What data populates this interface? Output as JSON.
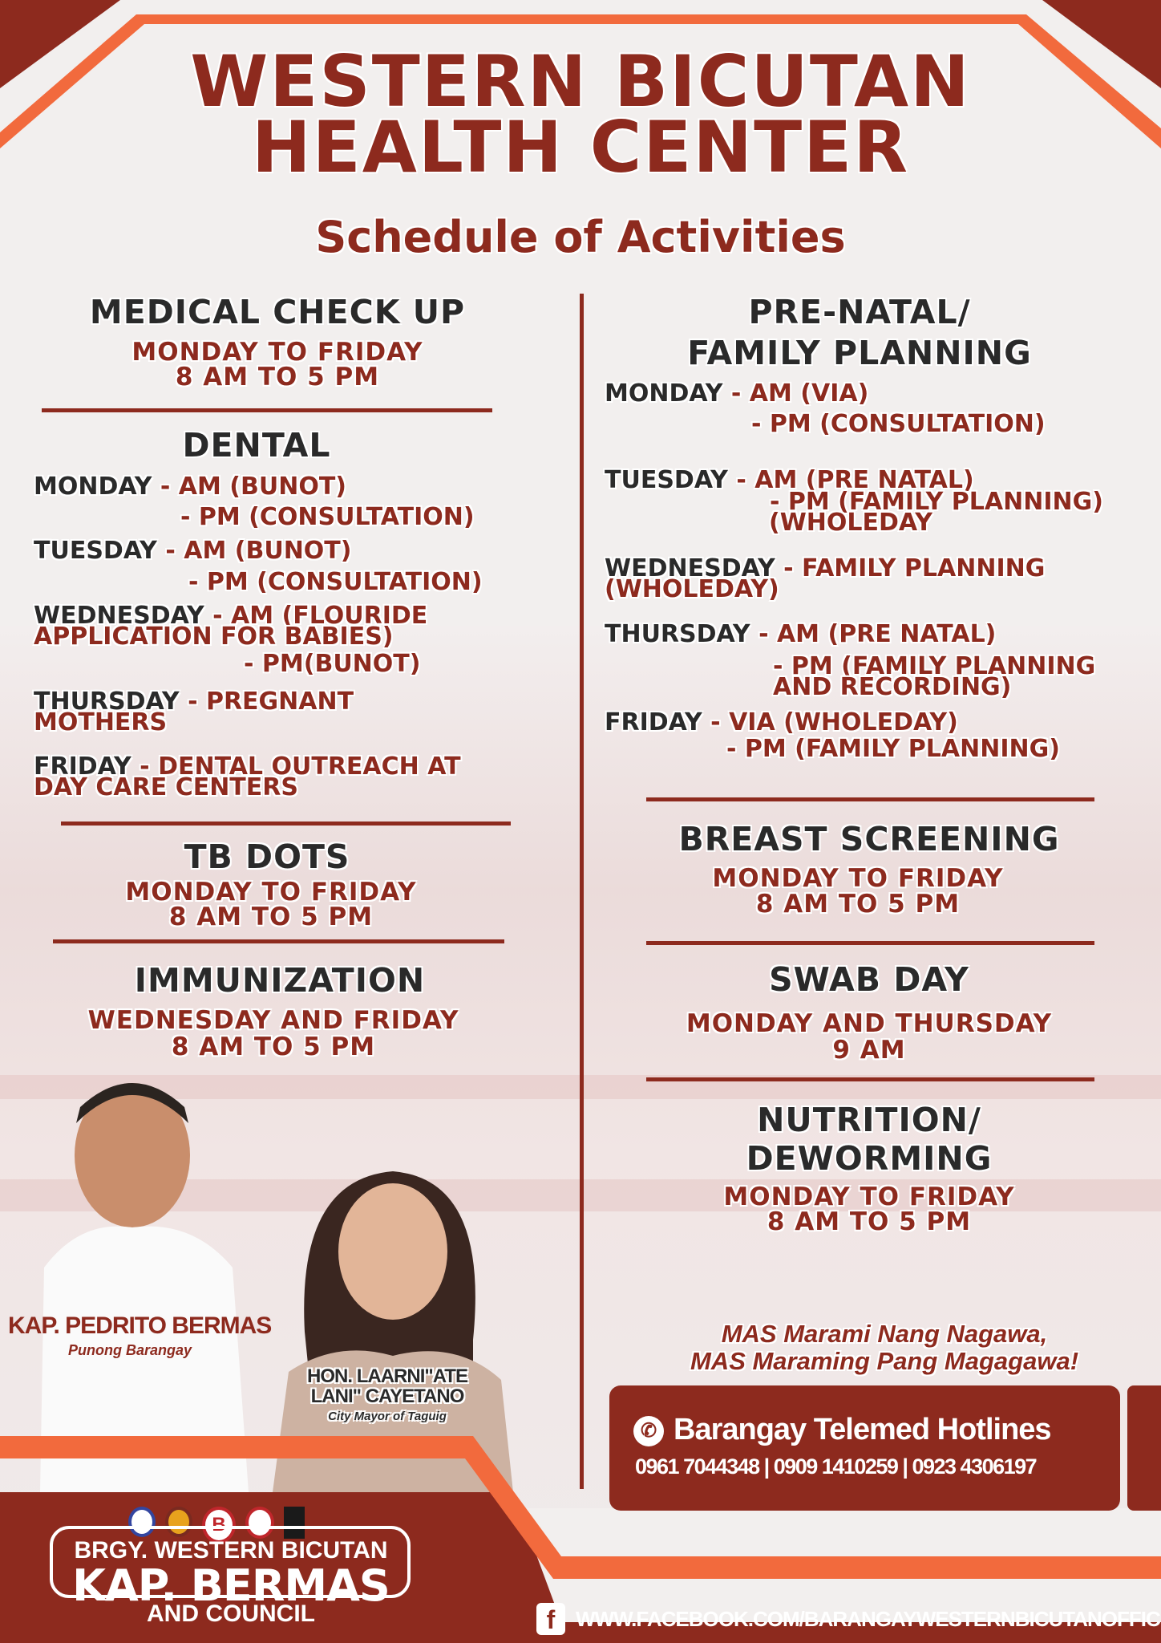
{
  "header": {
    "title_line1": "WESTERN BICUTAN",
    "title_line2": "HEALTH CENTER",
    "subtitle": "Schedule of Activities"
  },
  "left": {
    "medical": {
      "title": "MEDICAL CHECK UP",
      "line1": "MONDAY TO FRIDAY",
      "line2": "8 AM TO 5 PM"
    },
    "dental": {
      "title": "DENTAL",
      "rows": [
        {
          "day": "MONDAY",
          "text": " - AM (BUNOT)"
        },
        {
          "day": "",
          "text": "- PM (CONSULTATION)"
        },
        {
          "day": "TUESDAY",
          "text": " - AM (BUNOT)"
        },
        {
          "day": "",
          "text": "- PM (CONSULTATION)"
        },
        {
          "day": "WEDNESDAY",
          "text": " - AM (FLOURIDE"
        },
        {
          "day": "",
          "text": "APPLICATION FOR BABIES)"
        },
        {
          "day": "",
          "text": "- PM(BUNOT)"
        },
        {
          "day": "THURSDAY",
          "text": " - PREGNANT"
        },
        {
          "day": "",
          "text": "MOTHERS"
        },
        {
          "day": "FRIDAY",
          "text": " - DENTAL OUTREACH AT"
        },
        {
          "day": "",
          "text": "DAY CARE CENTERS"
        }
      ]
    },
    "tb": {
      "title": "TB DOTS",
      "line1": "MONDAY TO FRIDAY",
      "line2": "8 AM TO 5 PM"
    },
    "immunization": {
      "title": "IMMUNIZATION",
      "line1": "WEDNESDAY AND FRIDAY",
      "line2": "8 AM TO 5 PM"
    }
  },
  "right": {
    "prenatal": {
      "title1": "PRE-NATAL/",
      "title2": "FAMILY PLANNING",
      "rows": [
        {
          "day": "MONDAY",
          "text": " - AM (VIA)"
        },
        {
          "day": "",
          "text": "- PM (CONSULTATION)"
        },
        {
          "day": "TUESDAY",
          "text": " - AM (PRE NATAL)"
        },
        {
          "day": "",
          "text": "- PM (FAMILY PLANNING)"
        },
        {
          "day": "",
          "text": "(WHOLEDAY"
        },
        {
          "day": "WEDNESDAY",
          "text": " - FAMILY PLANNING"
        },
        {
          "day": "",
          "text": "(WHOLEDAY)"
        },
        {
          "day": "THURSDAY",
          "text": " - AM (PRE NATAL)"
        },
        {
          "day": "",
          "text": "- PM (FAMILY PLANNING"
        },
        {
          "day": "",
          "text": "AND RECORDING)"
        },
        {
          "day": "FRIDAY",
          "text": " - VIA (WHOLEDAY)"
        },
        {
          "day": "",
          "text": "- PM (FAMILY PLANNING)"
        }
      ]
    },
    "breast": {
      "title": "BREAST SCREENING",
      "line1": "MONDAY TO FRIDAY",
      "line2": "8 AM TO 5 PM"
    },
    "swab": {
      "title": "SWAB DAY",
      "line1": "MONDAY AND THURSDAY",
      "line2": "9 AM"
    },
    "nutrition": {
      "title1": "NUTRITION/",
      "title2": "DEWORMING",
      "line1": "MONDAY TO FRIDAY",
      "line2": "8 AM TO 5 PM"
    }
  },
  "people": {
    "kap_name": "KAP. PEDRITO BERMAS",
    "kap_role": "Punong Barangay",
    "mayor_name1": "HON. LAARNI\"ATE",
    "mayor_name2": "LANI\" CAYETANO",
    "mayor_role": "City Mayor of Taguig"
  },
  "slogan": {
    "line1": "MAS Marami Nang Nagawa,",
    "line2": "MAS Maraming Pang Magagawa!"
  },
  "hotline": {
    "title": "Barangay Telemed Hotlines",
    "numbers": "0961 7044348 | 0909 1410259 | 0923 4306197"
  },
  "footer": {
    "brgy": "BRGY. WESTERN BICUTAN",
    "kap": "KAP. BERMAS",
    "council": "AND COUNCIL",
    "facebook": "WWW.FACEBOOK.COM/BARANGAYWESTERNBICUTANOFFICIAL"
  },
  "colors": {
    "maroon": "#8d2a1e",
    "orange": "#f26a3d",
    "dark": "#2a2a2a"
  }
}
